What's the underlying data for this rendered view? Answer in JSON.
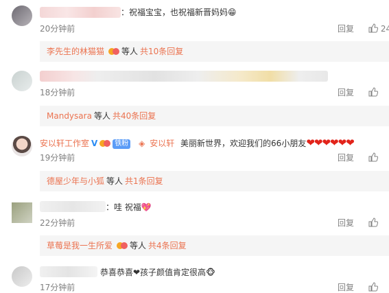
{
  "comments": [
    {
      "text": "：祝福宝宝，也祝福新晋妈妈😁",
      "time": "20分钟前",
      "reply_label": "回复",
      "like_count": "24",
      "sub": {
        "user": "李先生的林猫猫",
        "deng": "等人",
        "total": "共10条回复"
      }
    },
    {
      "text": "",
      "time": "18分钟前",
      "reply_label": "回复",
      "like_count": "",
      "sub": {
        "user": "Mandysara",
        "deng": "等人",
        "total": "共40条回复"
      }
    },
    {
      "author": "安以轩工作室",
      "fan_badge": "铁粉",
      "quoted_user": "安以轩",
      "text": "美丽新世界，欢迎我们的66小朋友",
      "hearts": "❤❤❤❤❤❤",
      "time": "19分钟前",
      "reply_label": "回复",
      "like_count": "",
      "sub": {
        "user": "德屋少年与小狐",
        "deng": "等人",
        "total": "共1条回复"
      }
    },
    {
      "text": "：哇 祝福💖",
      "time": "22分钟前",
      "reply_label": "回复",
      "like_count": "",
      "sub": {
        "user": "草莓是我一生所爱",
        "deng": "等人",
        "total": "共4条回复"
      }
    },
    {
      "text": "恭喜恭喜❤孩子颜值肯定很高🐵",
      "time": "17分钟前",
      "reply_label": "回复",
      "like_count": ""
    }
  ],
  "colors": {
    "accent": "#eb7350",
    "muted": "#808080",
    "sub_bg": "#f5f5f5",
    "fan_badge": "#5b9cf7",
    "heart": "#e2231a"
  }
}
